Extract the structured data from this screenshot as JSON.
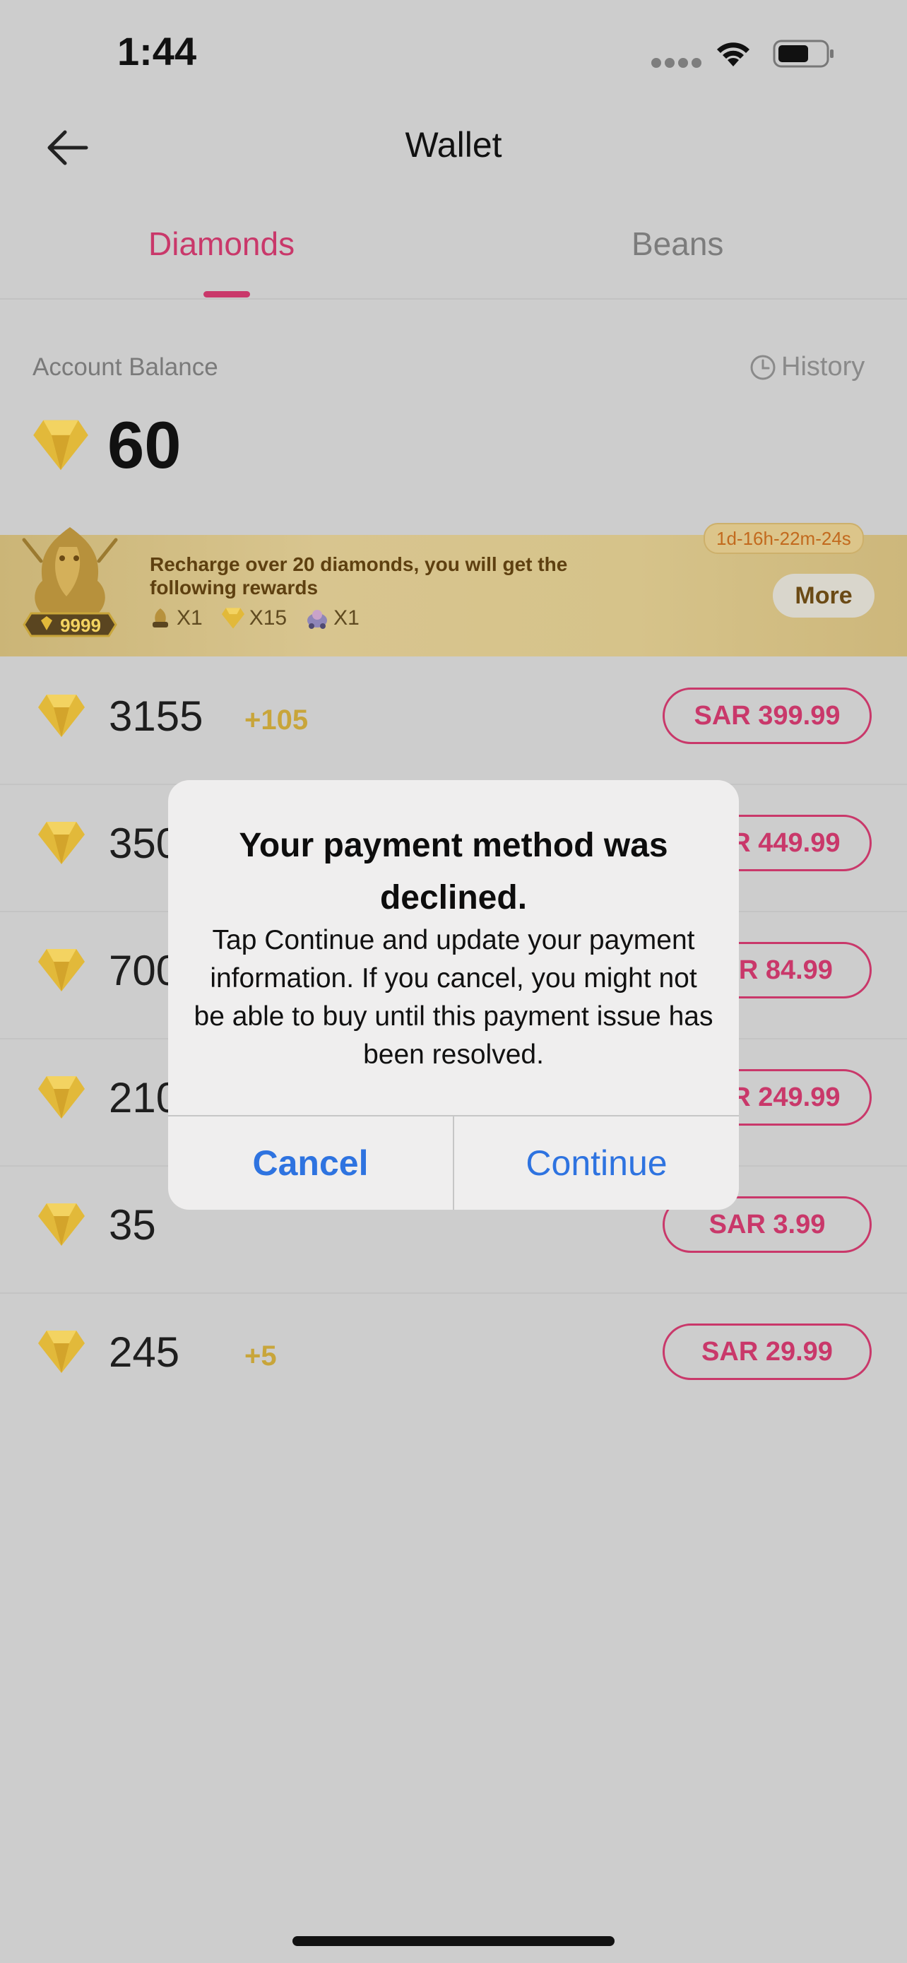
{
  "status_bar": {
    "time": "1:44"
  },
  "header": {
    "title": "Wallet"
  },
  "tabs": [
    {
      "label": "Diamonds",
      "active": true
    },
    {
      "label": "Beans",
      "active": false
    }
  ],
  "balance": {
    "label": "Account Balance",
    "history_label": "History",
    "value": "60"
  },
  "promo": {
    "countdown": "1d-16h-22m-24s",
    "text": "Recharge over 20 diamonds, you will get the following rewards",
    "badge_value": "9999",
    "rewards": [
      {
        "icon": "dragon-reward-icon",
        "qty": "X1"
      },
      {
        "icon": "diamond-icon",
        "qty": "X15"
      },
      {
        "icon": "chariot-reward-icon",
        "qty": "X1"
      }
    ],
    "more_label": "More"
  },
  "packages": [
    {
      "amount": "3155",
      "bonus": "+105",
      "price": "SAR 399.99"
    },
    {
      "amount": "350",
      "bonus": "",
      "price": "SAR 449.99"
    },
    {
      "amount": "700",
      "bonus": "",
      "price": "SAR 84.99"
    },
    {
      "amount": "210",
      "bonus": "",
      "price": "SAR 249.99"
    },
    {
      "amount": "35",
      "bonus": "",
      "price": "SAR 3.99"
    },
    {
      "amount": "245",
      "bonus": "+5",
      "price": "SAR 29.99"
    }
  ],
  "alert": {
    "title": "Your payment method was declined.",
    "message": "Tap Continue and update your payment information. If you cancel, you might not be able to buy until this payment issue has been resolved.",
    "cancel_label": "Cancel",
    "continue_label": "Continue"
  },
  "colors": {
    "accent": "#c9386a",
    "gold": "#c8a53a",
    "ios_blue": "#2e73e0",
    "dimmed_background": "#cdcdcd"
  }
}
